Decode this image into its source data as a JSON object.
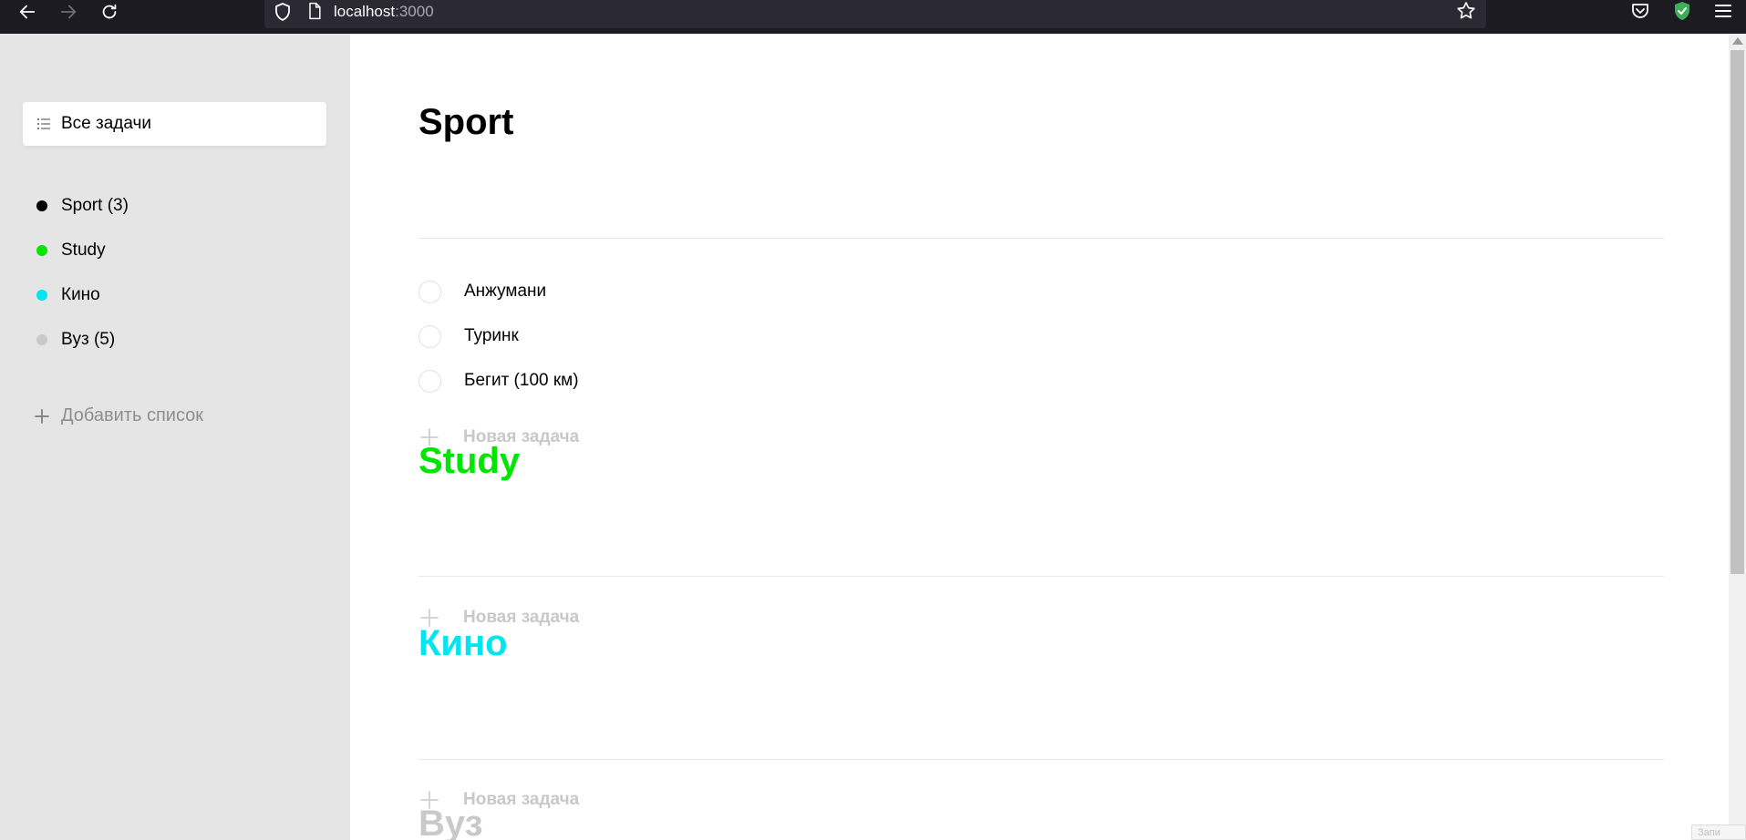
{
  "browser": {
    "url_host": "localhost",
    "url_port": ":3000"
  },
  "sidebar": {
    "all_tasks_label": "Все задачи",
    "lists": [
      {
        "label": "Sport (3)",
        "color": "#000000"
      },
      {
        "label": "Study",
        "color": "#00e600"
      },
      {
        "label": "Кино",
        "color": "#00e5ee"
      },
      {
        "label": "Вуз (5)",
        "color": "#c9c9c9"
      }
    ],
    "add_list_label": "Добавить список"
  },
  "main": {
    "sections": [
      {
        "title": "Sport",
        "color": "#000000",
        "tasks": [
          "Анжумани",
          "Туринк",
          "Бегит (100 км)"
        ],
        "new_task_label": "Новая задача"
      },
      {
        "title": "Study",
        "color": "#00e600",
        "tasks": [],
        "new_task_label": "Новая задача"
      },
      {
        "title": "Кино",
        "color": "#00e5ee",
        "tasks": [],
        "new_task_label": "Новая задача"
      },
      {
        "title": "Вуз",
        "color": "#c9c9c9",
        "tasks": []
      }
    ]
  },
  "corner_chip_text": "Запи"
}
